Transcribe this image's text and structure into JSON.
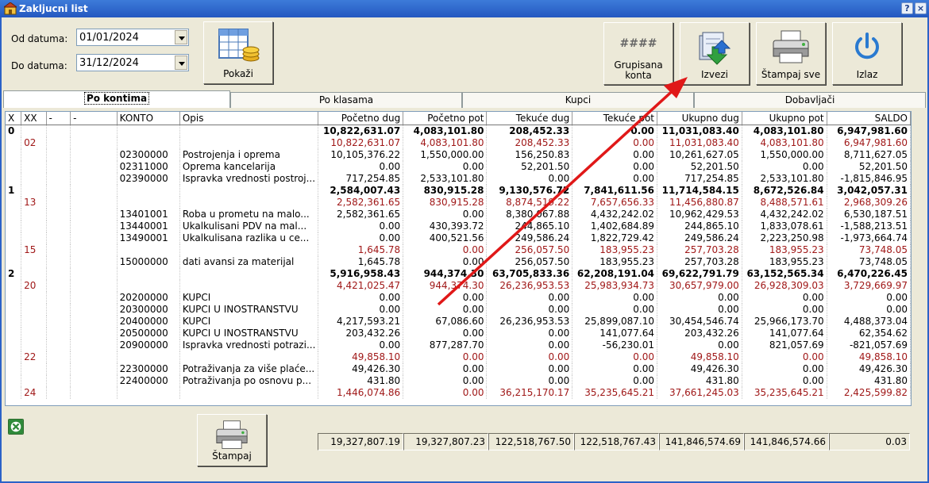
{
  "window": {
    "title": "Zakljucni list",
    "help_label": "?",
    "close_label": "×"
  },
  "filters": {
    "from_label": "Od datuma:",
    "from_value": "01/01/2024",
    "to_label": "Do datuma:",
    "to_value": "31/12/2024"
  },
  "toolbar": {
    "show_label": "Pokaži",
    "group_icon_text": "####",
    "group_label_1": "Grupisana",
    "group_label_2": "konta",
    "export_label": "Izvezi",
    "print_all_label": "Štampaj sve",
    "exit_label": "Izlaz"
  },
  "tabs": [
    {
      "label": "Po kontima",
      "active": true
    },
    {
      "label": "Po klasama",
      "active": false
    },
    {
      "label": "Kupci",
      "active": false
    },
    {
      "label": "Dobavljači",
      "active": false
    }
  ],
  "grid": {
    "columns": [
      "X",
      "XX",
      "-",
      "-",
      "KONTO",
      "Opis",
      "Početno dug",
      "Početno pot",
      "Tekuće dug",
      "Tekuće pot",
      "Ukupno dug",
      "Ukupno pot",
      "SALDO"
    ],
    "rows": [
      {
        "level": 0,
        "x": "0",
        "xx": "",
        "konto": "",
        "opis": "",
        "v": [
          "10,822,631.07",
          "4,083,101.80",
          "208,452.33",
          "0.00",
          "11,031,083.40",
          "4,083,101.80",
          "6,947,981.60"
        ]
      },
      {
        "level": 1,
        "x": "",
        "xx": "02",
        "konto": "",
        "opis": "",
        "v": [
          "10,822,631.07",
          "4,083,101.80",
          "208,452.33",
          "0.00",
          "11,031,083.40",
          "4,083,101.80",
          "6,947,981.60"
        ]
      },
      {
        "level": 2,
        "x": "",
        "xx": "",
        "konto": "02300000",
        "opis": "Postrojenja i oprema",
        "v": [
          "10,105,376.22",
          "1,550,000.00",
          "156,250.83",
          "0.00",
          "10,261,627.05",
          "1,550,000.00",
          "8,711,627.05"
        ]
      },
      {
        "level": 2,
        "x": "",
        "xx": "",
        "konto": "02311000",
        "opis": "Oprema kancelarija",
        "v": [
          "0.00",
          "0.00",
          "52,201.50",
          "0.00",
          "52,201.50",
          "0.00",
          "52,201.50"
        ]
      },
      {
        "level": 2,
        "x": "",
        "xx": "",
        "konto": "02390000",
        "opis": "Ispravka vrednosti postroj...",
        "v": [
          "717,254.85",
          "2,533,101.80",
          "0.00",
          "0.00",
          "717,254.85",
          "2,533,101.80",
          "-1,815,846.95"
        ]
      },
      {
        "level": 0,
        "x": "1",
        "xx": "",
        "konto": "",
        "opis": "",
        "v": [
          "2,584,007.43",
          "830,915.28",
          "9,130,576.72",
          "7,841,611.56",
          "11,714,584.15",
          "8,672,526.84",
          "3,042,057.31"
        ]
      },
      {
        "level": 1,
        "x": "",
        "xx": "13",
        "konto": "",
        "opis": "",
        "v": [
          "2,582,361.65",
          "830,915.28",
          "8,874,519.22",
          "7,657,656.33",
          "11,456,880.87",
          "8,488,571.61",
          "2,968,309.26"
        ]
      },
      {
        "level": 2,
        "x": "",
        "xx": "",
        "konto": "13401001",
        "opis": "Roba u prometu na malo...",
        "v": [
          "2,582,361.65",
          "0.00",
          "8,380,067.88",
          "4,432,242.02",
          "10,962,429.53",
          "4,432,242.02",
          "6,530,187.51"
        ]
      },
      {
        "level": 2,
        "x": "",
        "xx": "",
        "konto": "13440001",
        "opis": "Ukalkulisani PDV na mal...",
        "v": [
          "0.00",
          "430,393.72",
          "244,865.10",
          "1,402,684.89",
          "244,865.10",
          "1,833,078.61",
          "-1,588,213.51"
        ]
      },
      {
        "level": 2,
        "x": "",
        "xx": "",
        "konto": "13490001",
        "opis": "Ukalkulisana razlika u ce...",
        "v": [
          "0.00",
          "400,521.56",
          "249,586.24",
          "1,822,729.42",
          "249,586.24",
          "2,223,250.98",
          "-1,973,664.74"
        ]
      },
      {
        "level": 1,
        "x": "",
        "xx": "15",
        "konto": "",
        "opis": "",
        "v": [
          "1,645.78",
          "0.00",
          "256,057.50",
          "183,955.23",
          "257,703.28",
          "183,955.23",
          "73,748.05"
        ]
      },
      {
        "level": 2,
        "x": "",
        "xx": "",
        "konto": "15000000",
        "opis": "dati avansi za materijal",
        "v": [
          "1,645.78",
          "0.00",
          "256,057.50",
          "183,955.23",
          "257,703.28",
          "183,955.23",
          "73,748.05"
        ]
      },
      {
        "level": 0,
        "x": "2",
        "xx": "",
        "konto": "",
        "opis": "",
        "v": [
          "5,916,958.43",
          "944,374.30",
          "63,705,833.36",
          "62,208,191.04",
          "69,622,791.79",
          "63,152,565.34",
          "6,470,226.45"
        ]
      },
      {
        "level": 1,
        "x": "",
        "xx": "20",
        "konto": "",
        "opis": "",
        "v": [
          "4,421,025.47",
          "944,374.30",
          "26,236,953.53",
          "25,983,934.73",
          "30,657,979.00",
          "26,928,309.03",
          "3,729,669.97"
        ]
      },
      {
        "level": 2,
        "x": "",
        "xx": "",
        "konto": "20200000",
        "opis": "KUPCI",
        "v": [
          "0.00",
          "0.00",
          "0.00",
          "0.00",
          "0.00",
          "0.00",
          "0.00"
        ]
      },
      {
        "level": 2,
        "x": "",
        "xx": "",
        "konto": "20300000",
        "opis": "KUPCI U INOSTRANSTVU",
        "v": [
          "0.00",
          "0.00",
          "0.00",
          "0.00",
          "0.00",
          "0.00",
          "0.00"
        ]
      },
      {
        "level": 2,
        "x": "",
        "xx": "",
        "konto": "20400000",
        "opis": "KUPCI",
        "v": [
          "4,217,593.21",
          "67,086.60",
          "26,236,953.53",
          "25,899,087.10",
          "30,454,546.74",
          "25,966,173.70",
          "4,488,373.04"
        ]
      },
      {
        "level": 2,
        "x": "",
        "xx": "",
        "konto": "20500000",
        "opis": "KUPCI U INOSTRANSTVU",
        "v": [
          "203,432.26",
          "0.00",
          "0.00",
          "141,077.64",
          "203,432.26",
          "141,077.64",
          "62,354.62"
        ]
      },
      {
        "level": 2,
        "x": "",
        "xx": "",
        "konto": "20900000",
        "opis": "Ispravka vrednosti potrazi...",
        "v": [
          "0.00",
          "877,287.70",
          "0.00",
          "-56,230.01",
          "0.00",
          "821,057.69",
          "-821,057.69"
        ]
      },
      {
        "level": 1,
        "x": "",
        "xx": "22",
        "konto": "",
        "opis": "",
        "v": [
          "49,858.10",
          "0.00",
          "0.00",
          "0.00",
          "49,858.10",
          "0.00",
          "49,858.10"
        ]
      },
      {
        "level": 2,
        "x": "",
        "xx": "",
        "konto": "22300000",
        "opis": "Potraživanja za više plaće...",
        "v": [
          "49,426.30",
          "0.00",
          "0.00",
          "0.00",
          "49,426.30",
          "0.00",
          "49,426.30"
        ]
      },
      {
        "level": 2,
        "x": "",
        "xx": "",
        "konto": "22400000",
        "opis": "Potraživanja po osnovu p...",
        "v": [
          "431.80",
          "0.00",
          "0.00",
          "0.00",
          "431.80",
          "0.00",
          "431.80"
        ]
      },
      {
        "level": 1,
        "x": "",
        "xx": "24",
        "konto": "",
        "opis": "",
        "v": [
          "1,446,074.86",
          "0.00",
          "36,215,170.17",
          "35,235,645.21",
          "37,661,245.03",
          "35,235,645.21",
          "2,425,599.82"
        ]
      }
    ]
  },
  "footer": {
    "print_label": "Štampaj",
    "totals": [
      "19,327,807.19",
      "19,327,807.23",
      "122,518,767.50",
      "122,518,767.43",
      "141,846,574.69",
      "141,846,574.66",
      "0.03"
    ]
  },
  "colors": {
    "titlebar": "#2458c0",
    "group_total_text": "#a01818",
    "annotation_arrow": "#e01818"
  }
}
